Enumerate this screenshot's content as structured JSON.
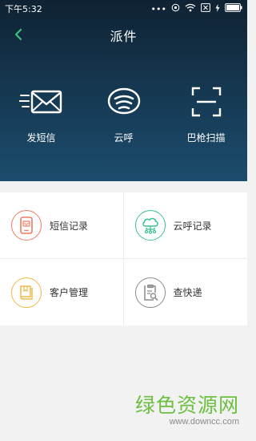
{
  "status": {
    "time": "下午5:32",
    "dots": "•••"
  },
  "header": {
    "title": "派件"
  },
  "actions": [
    {
      "label": "发短信",
      "icon": "envelope-icon"
    },
    {
      "label": "云呼",
      "icon": "cloud-call-icon"
    },
    {
      "label": "巴枪扫描",
      "icon": "scan-frame-icon"
    }
  ],
  "grid": [
    {
      "label": "短信记录",
      "icon": "sms-record-icon",
      "color": "#f07a62"
    },
    {
      "label": "云呼记录",
      "icon": "cloud-record-icon",
      "color": "#37c48f"
    },
    {
      "label": "客户管理",
      "icon": "customer-book-icon",
      "color": "#f2b84a"
    },
    {
      "label": "查快递",
      "icon": "track-parcel-icon",
      "color": "#8c8c8c"
    }
  ],
  "watermark": {
    "title": "绿色资源网",
    "url": "www.downcc.com"
  }
}
